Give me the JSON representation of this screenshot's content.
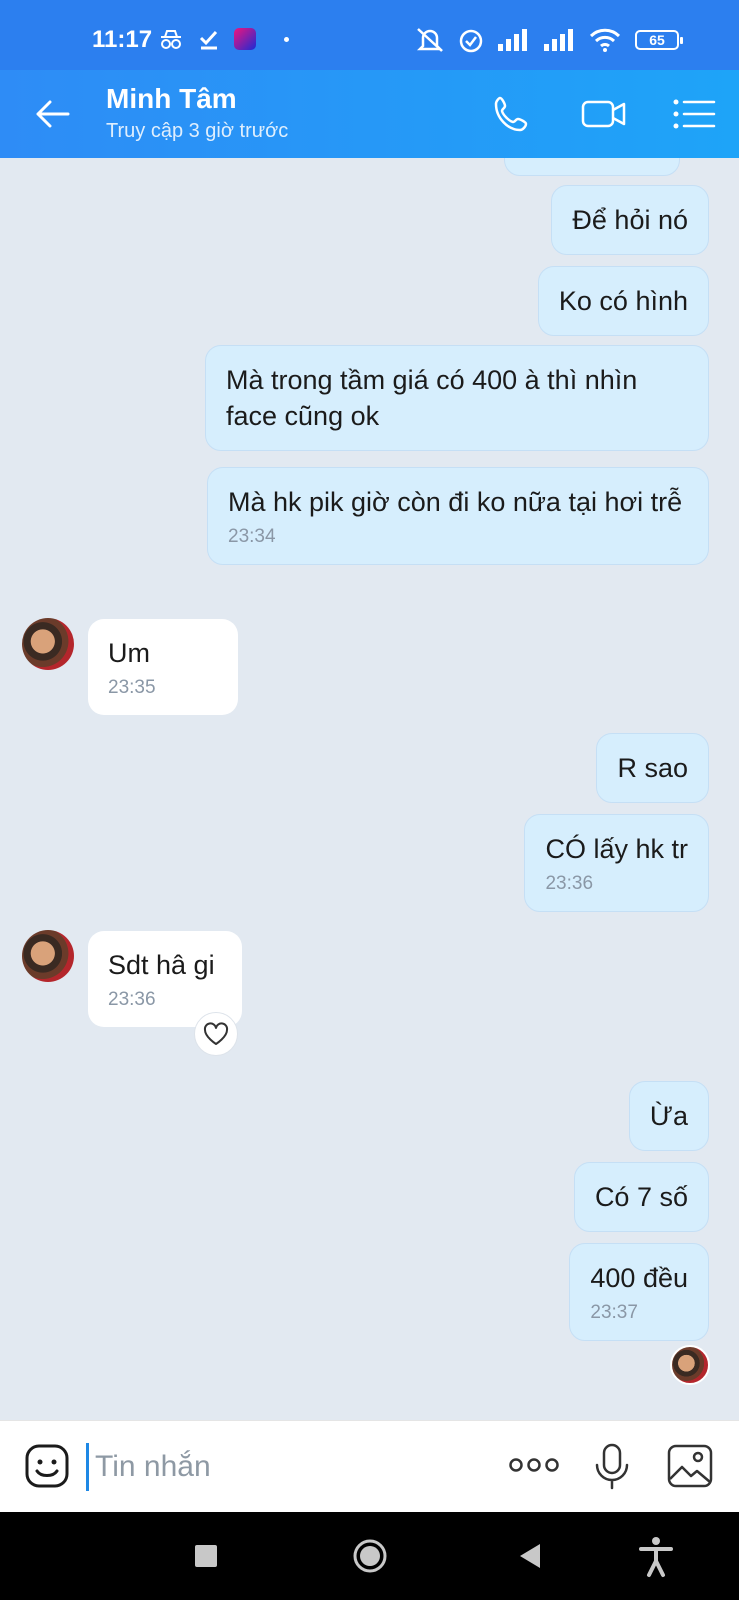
{
  "status_bar": {
    "time": "11:17",
    "battery": "65",
    "icons": [
      "incognito-icon",
      "check-download-icon",
      "lazada-app-icon",
      "dot-icon",
      "mute-icon",
      "alarm-icon",
      "signal-icon",
      "signal-icon",
      "wifi-icon",
      "battery-icon"
    ]
  },
  "header": {
    "name": "Minh Tâm",
    "status": "Truy cập 3 giờ trước",
    "icons": [
      "back-arrow-icon",
      "phone-icon",
      "video-call-icon",
      "menu-list-icon"
    ]
  },
  "messages": [
    {
      "side": "out",
      "text": "Để hỏi nó",
      "time": ""
    },
    {
      "side": "out",
      "text": "Ko có hình",
      "time": ""
    },
    {
      "side": "out",
      "text": "Mà trong tầm giá có 400 à thì nhìn face cũng ok",
      "time": ""
    },
    {
      "side": "out",
      "text": "Mà hk pik giờ còn đi ko nữa tại hơi trễ",
      "time": "23:34"
    },
    {
      "side": "in",
      "text": "Um",
      "time": "23:35"
    },
    {
      "side": "out",
      "text": "R sao",
      "time": ""
    },
    {
      "side": "out",
      "text": "CÓ lấy hk tr",
      "time": "23:36"
    },
    {
      "side": "in",
      "text": "Sdt hâ gi",
      "time": "23:36"
    },
    {
      "side": "out",
      "text": "Ừa",
      "time": ""
    },
    {
      "side": "out",
      "text": "Có 7 số",
      "time": ""
    },
    {
      "side": "out",
      "text": "400 đều",
      "time": "23:37"
    }
  ],
  "input": {
    "placeholder": "Tin nhắn"
  },
  "colors": {
    "header": "#2e8cf6",
    "chat_bg": "#e2e9f1",
    "outgoing_bubble": "#d6eefd",
    "incoming_bubble": "#ffffff"
  }
}
